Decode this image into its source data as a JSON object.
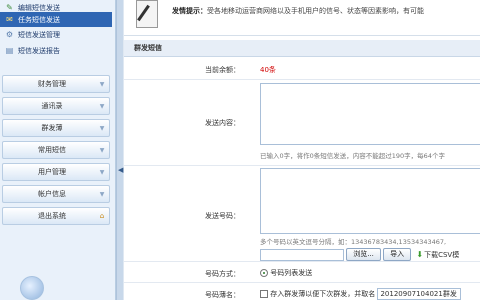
{
  "sidebar": {
    "sub_items": [
      {
        "label": "编辑短信发送",
        "icon": "pencil-icon",
        "active": false
      },
      {
        "label": "任务短信发送",
        "icon": "envelope-icon",
        "active": true
      },
      {
        "label": "短信发送管理",
        "icon": "settings-icon",
        "active": false
      },
      {
        "label": "短信发送报告",
        "icon": "report-icon",
        "active": false
      }
    ],
    "menus": [
      {
        "label": "财务管理"
      },
      {
        "label": "通讯录"
      },
      {
        "label": "群发薄"
      },
      {
        "label": "常用短信"
      },
      {
        "label": "用户管理"
      },
      {
        "label": "帐户信息"
      },
      {
        "label": "退出系统"
      }
    ]
  },
  "notice": {
    "title": "发情提示：",
    "text": "受各地移动运营商网络以及手机用户的信号、状态等因素影响，有可能"
  },
  "form": {
    "section_title": "群发短信",
    "balance_label": "当前余额：",
    "balance_value": "40条",
    "content_label": "发送内容：",
    "content_value": "",
    "content_hint": "已输入0字，将作0条短信发送，内容不能超过190字，每64个字",
    "numbers_label": "发送号码：",
    "numbers_value": "",
    "numbers_hint": "多个号码以英文逗号分隔，如：13436783434,13534343467,",
    "browse_label": "浏览...",
    "import_label": "导入",
    "download_label": "下载CSV模",
    "mode_label": "号码方式：",
    "mode_option": "号码列表发送",
    "groupname_label": "号码薄名：",
    "save_label": "存入群发薄以便下次群发，并取名",
    "groupname_value": "20120907104021群发"
  }
}
